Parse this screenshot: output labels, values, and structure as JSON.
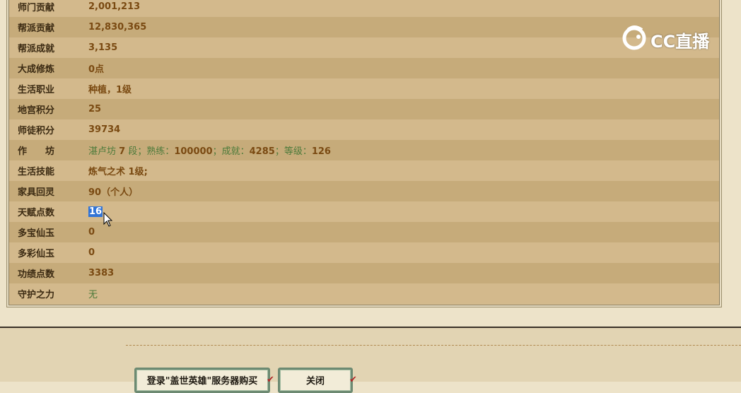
{
  "stats": [
    {
      "label": "师门贡献",
      "value": "2,001,213",
      "style": "val"
    },
    {
      "label": "帮派贡献",
      "value": "12,830,365",
      "style": "val"
    },
    {
      "label": "帮派成就",
      "value": "3,135",
      "style": "val"
    },
    {
      "label": "大成修炼",
      "value": "0点",
      "style": "val"
    },
    {
      "label": "生活职业",
      "value": "种植，1级",
      "style": "val"
    },
    {
      "label": "地宫积分",
      "value": "25",
      "style": "val"
    },
    {
      "label": "师徒积分",
      "value": "39734",
      "style": "val"
    },
    {
      "label": "作　　坊",
      "style": "mix",
      "parts": [
        {
          "t": "湛卢坊 ",
          "b": false
        },
        {
          "t": "7",
          "b": true
        },
        {
          "t": " 段；熟练：",
          "b": false
        },
        {
          "t": "100000",
          "b": true
        },
        {
          "t": "；成就：",
          "b": false
        },
        {
          "t": "4285",
          "b": true
        },
        {
          "t": "；等级：",
          "b": false
        },
        {
          "t": "126",
          "b": true
        }
      ]
    },
    {
      "label": "生活技能",
      "value": "炼气之术 1级;",
      "style": "val"
    },
    {
      "label": "家具回灵",
      "value": "90（个人）",
      "style": "val"
    },
    {
      "label": "天赋点数",
      "value": "16",
      "style": "selected"
    },
    {
      "label": "多宝仙玉",
      "value": "0",
      "style": "val"
    },
    {
      "label": "多彩仙玉",
      "value": "0",
      "style": "val"
    },
    {
      "label": "功绩点数",
      "value": "3383",
      "style": "val"
    },
    {
      "label": "守护之力",
      "value": "无",
      "style": "green"
    }
  ],
  "watermark": {
    "text": "CC直播",
    "icon": "cc-live-logo-icon"
  },
  "buttons": {
    "login_server": "登录\"盖世英雄\"服务器购买",
    "close": "关闭"
  },
  "colors": {
    "label": "#3b2a12",
    "value": "#7a4a12",
    "green_value": "#4c7a3a",
    "selection": "#3174d6"
  }
}
